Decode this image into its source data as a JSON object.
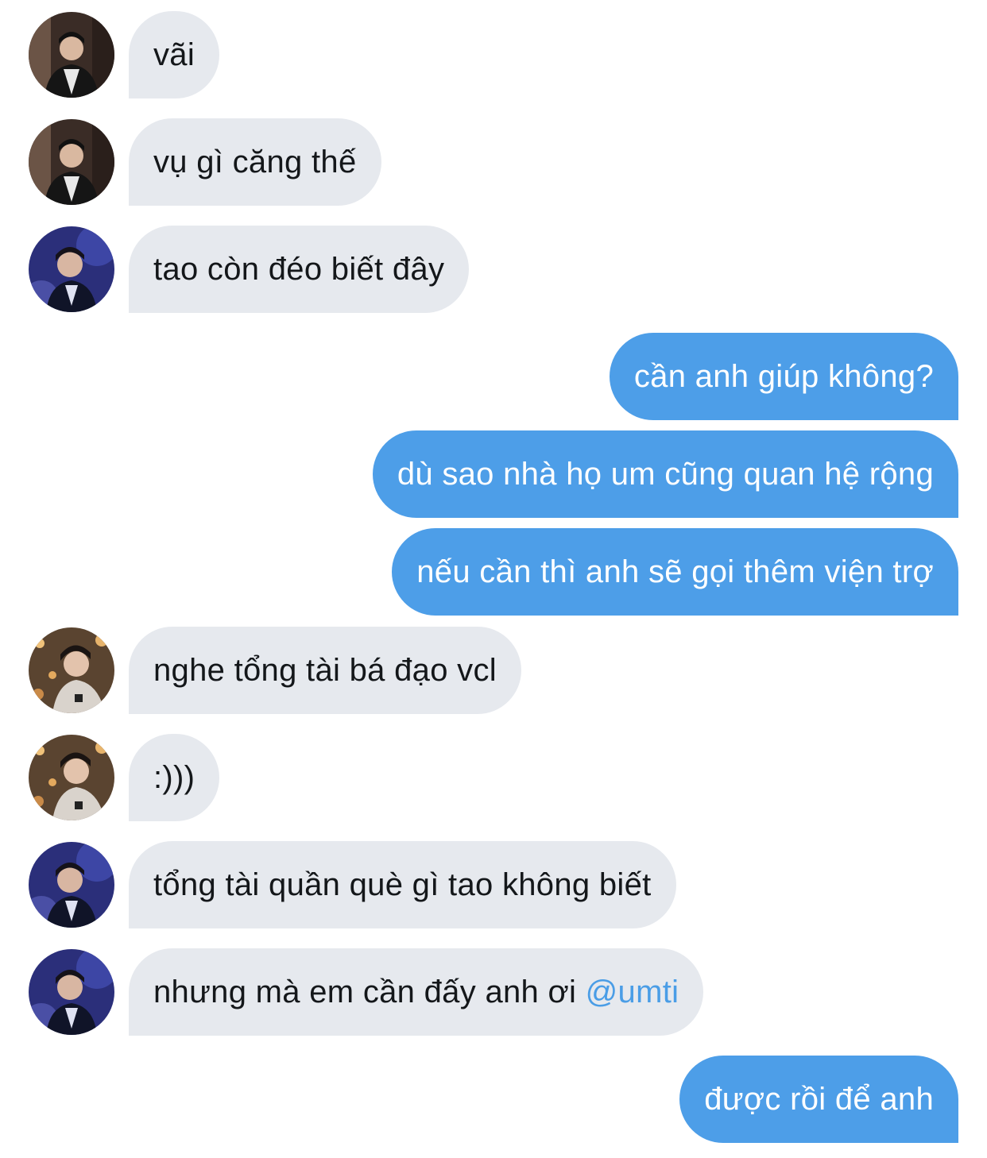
{
  "colors": {
    "incoming_bubble": "#e6e9ee",
    "outgoing_bubble": "#4d9ee8",
    "incoming_text": "#14171a",
    "outgoing_text": "#ffffff",
    "mention": "#4a9de6"
  },
  "messages": [
    {
      "direction": "in",
      "avatar": "user-a-avatar",
      "text": "vãi"
    },
    {
      "direction": "in",
      "avatar": "user-a-avatar",
      "text": "vụ gì căng thế"
    },
    {
      "direction": "in",
      "avatar": "user-b-avatar",
      "text": "tao còn đéo biết đây"
    },
    {
      "direction": "out",
      "text": "cần anh giúp không?"
    },
    {
      "direction": "out",
      "text": "dù sao nhà họ um cũng quan hệ rộng"
    },
    {
      "direction": "out",
      "text": "nếu cần thì anh sẽ gọi thêm viện trợ"
    },
    {
      "direction": "in",
      "avatar": "user-c-avatar",
      "text": "nghe tổng tài bá đạo vcl"
    },
    {
      "direction": "in",
      "avatar": "user-c-avatar",
      "text": ":)))"
    },
    {
      "direction": "in",
      "avatar": "user-b-avatar",
      "text": "tổng tài quần què gì tao không biết"
    },
    {
      "direction": "in",
      "avatar": "user-b-avatar",
      "text": "nhưng mà em cần đấy anh ơi ",
      "mention": "@umti"
    },
    {
      "direction": "out",
      "text": "được rồi để anh"
    }
  ]
}
